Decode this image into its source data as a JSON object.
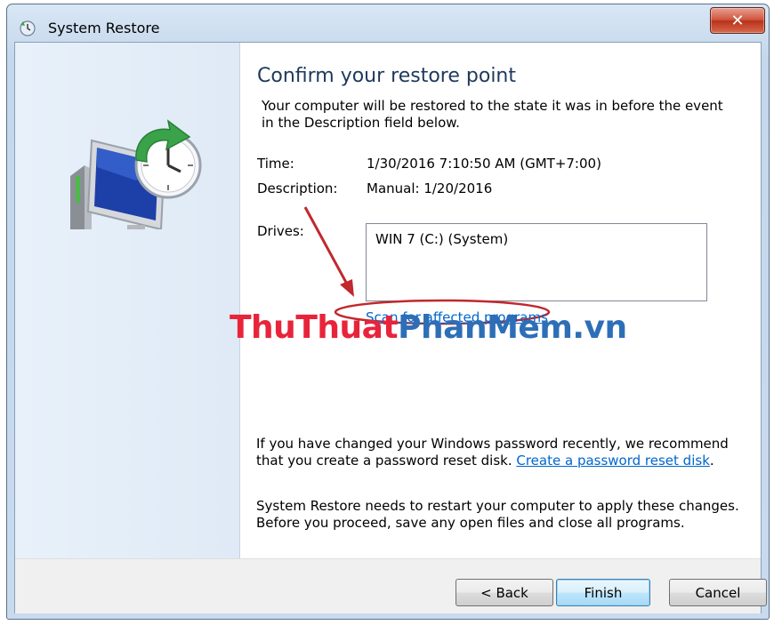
{
  "window": {
    "title": "System Restore",
    "close_symbol": "✕"
  },
  "content": {
    "heading": "Confirm your restore point",
    "intro": "Your computer will be restored to the state it was in before the event in the Description field below.",
    "time_label": "Time:",
    "time_value": "1/30/2016 7:10:50 AM (GMT+7:00)",
    "description_label": "Description:",
    "description_value": "Manual: 1/20/2016",
    "drives_label": "Drives:",
    "drives": [
      "WIN 7 (C:) (System)"
    ],
    "scan_link": "Scan for affected programs",
    "password_text_pre": "If you have changed your Windows password recently, we recommend that you create a password reset disk. ",
    "password_link": "Create a password reset disk",
    "password_text_post": ".",
    "restart_text": "System Restore needs to restart your computer to apply these changes. Before you proceed, save any open files and close all programs."
  },
  "buttons": {
    "back": "< Back",
    "finish": "Finish",
    "cancel": "Cancel"
  },
  "watermark": {
    "part1": "ThuThuat",
    "part2": "PhanMem.vn"
  },
  "icons": {
    "title": "system-restore-icon",
    "hero": "computer-clock-restore-icon",
    "annotation": "red-arrow-icon"
  },
  "colors": {
    "heading": "#1e395b",
    "link": "#0066cc",
    "annotation": "#c0282d",
    "watermark_red": "#e8243b",
    "watermark_blue": "#2d6fb7"
  }
}
